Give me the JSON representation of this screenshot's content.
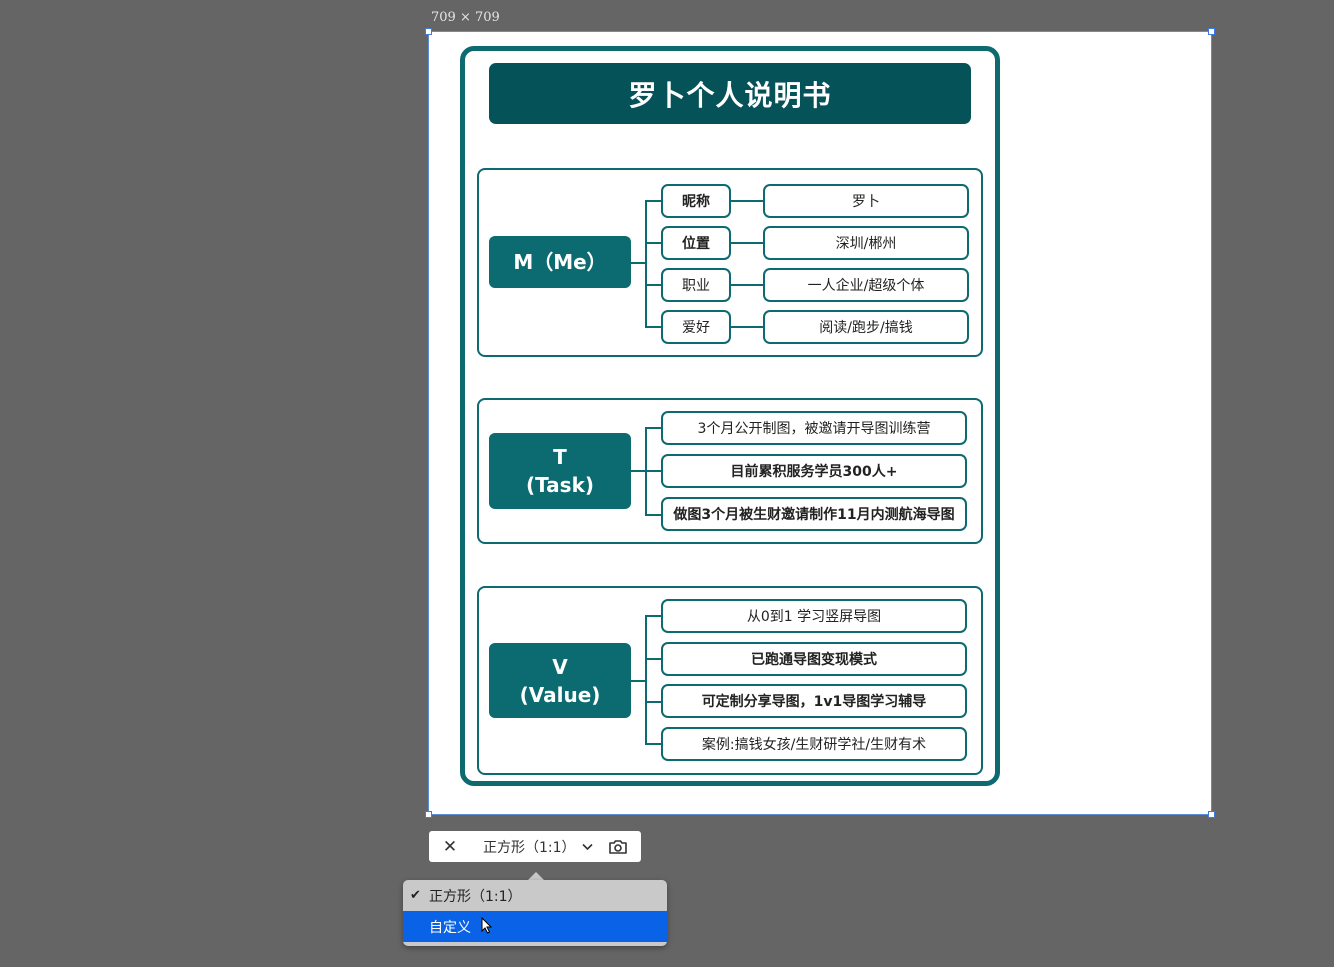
{
  "canvas": {
    "dimensions_label": "709 × 709"
  },
  "card": {
    "title": "罗卜个人说明书",
    "sections": [
      {
        "root": "M（Me）",
        "nodes": [
          {
            "key": "昵称",
            "value": "罗卜",
            "bold": true
          },
          {
            "key": "位置",
            "value": "深圳/郴州",
            "bold": true
          },
          {
            "key": "职业",
            "value": "一人企业/超级个体",
            "bold": false
          },
          {
            "key": "爱好",
            "value": "阅读/跑步/搞钱",
            "bold": false
          }
        ]
      },
      {
        "root": "T\n(Task)",
        "items": [
          {
            "text": "3个月公开制图，被邀请开导图训练营",
            "bold": false
          },
          {
            "text": "目前累积服务学员300人+",
            "bold": true
          },
          {
            "text": "做图3个月被生财邀请制作11月内测航海导图",
            "bold": true
          }
        ]
      },
      {
        "root": "V\n(Value)",
        "items": [
          {
            "text": "从0到1 学习竖屏导图",
            "bold": false
          },
          {
            "text": "已跑通导图变现模式",
            "bold": true
          },
          {
            "text": "可定制分享导图，1v1导图学习辅导",
            "bold": true
          },
          {
            "text": "案例:搞钱女孩/生财研学社/生财有术",
            "bold": false
          }
        ]
      }
    ]
  },
  "toolbar": {
    "close_icon": "close-icon",
    "ratio_label": "正方形（1:1）",
    "camera_icon": "camera-icon"
  },
  "dropdown": {
    "options": [
      {
        "label": "正方形（1:1）",
        "checked": true
      },
      {
        "label": "自定义",
        "highlighted": true
      }
    ]
  },
  "colors": {
    "accent": "#0d6a70",
    "title_bg": "#065259",
    "selection": "#0a63e6"
  }
}
